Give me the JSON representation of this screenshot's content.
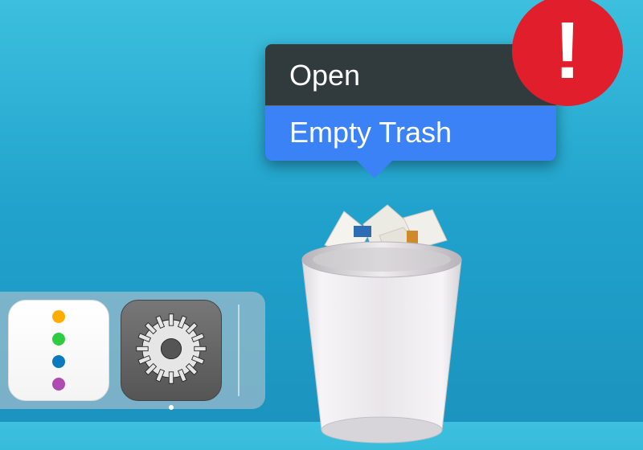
{
  "colors": {
    "badge": "#e11e2b",
    "menu_highlight": "#3b82f6",
    "notes_dots": [
      "#ffae00",
      "#2ecc40",
      "#0a7abf",
      "#b04ab3"
    ]
  },
  "dock": {
    "items": [
      {
        "name": "notes",
        "running": false
      },
      {
        "name": "system-preferences",
        "running": true
      }
    ],
    "trash": {
      "name": "trash",
      "full": true
    }
  },
  "context_menu": {
    "items": [
      {
        "label": "Open",
        "selected": false
      },
      {
        "label": "Empty Trash",
        "selected": true
      }
    ]
  },
  "badge": {
    "glyph": "!"
  }
}
